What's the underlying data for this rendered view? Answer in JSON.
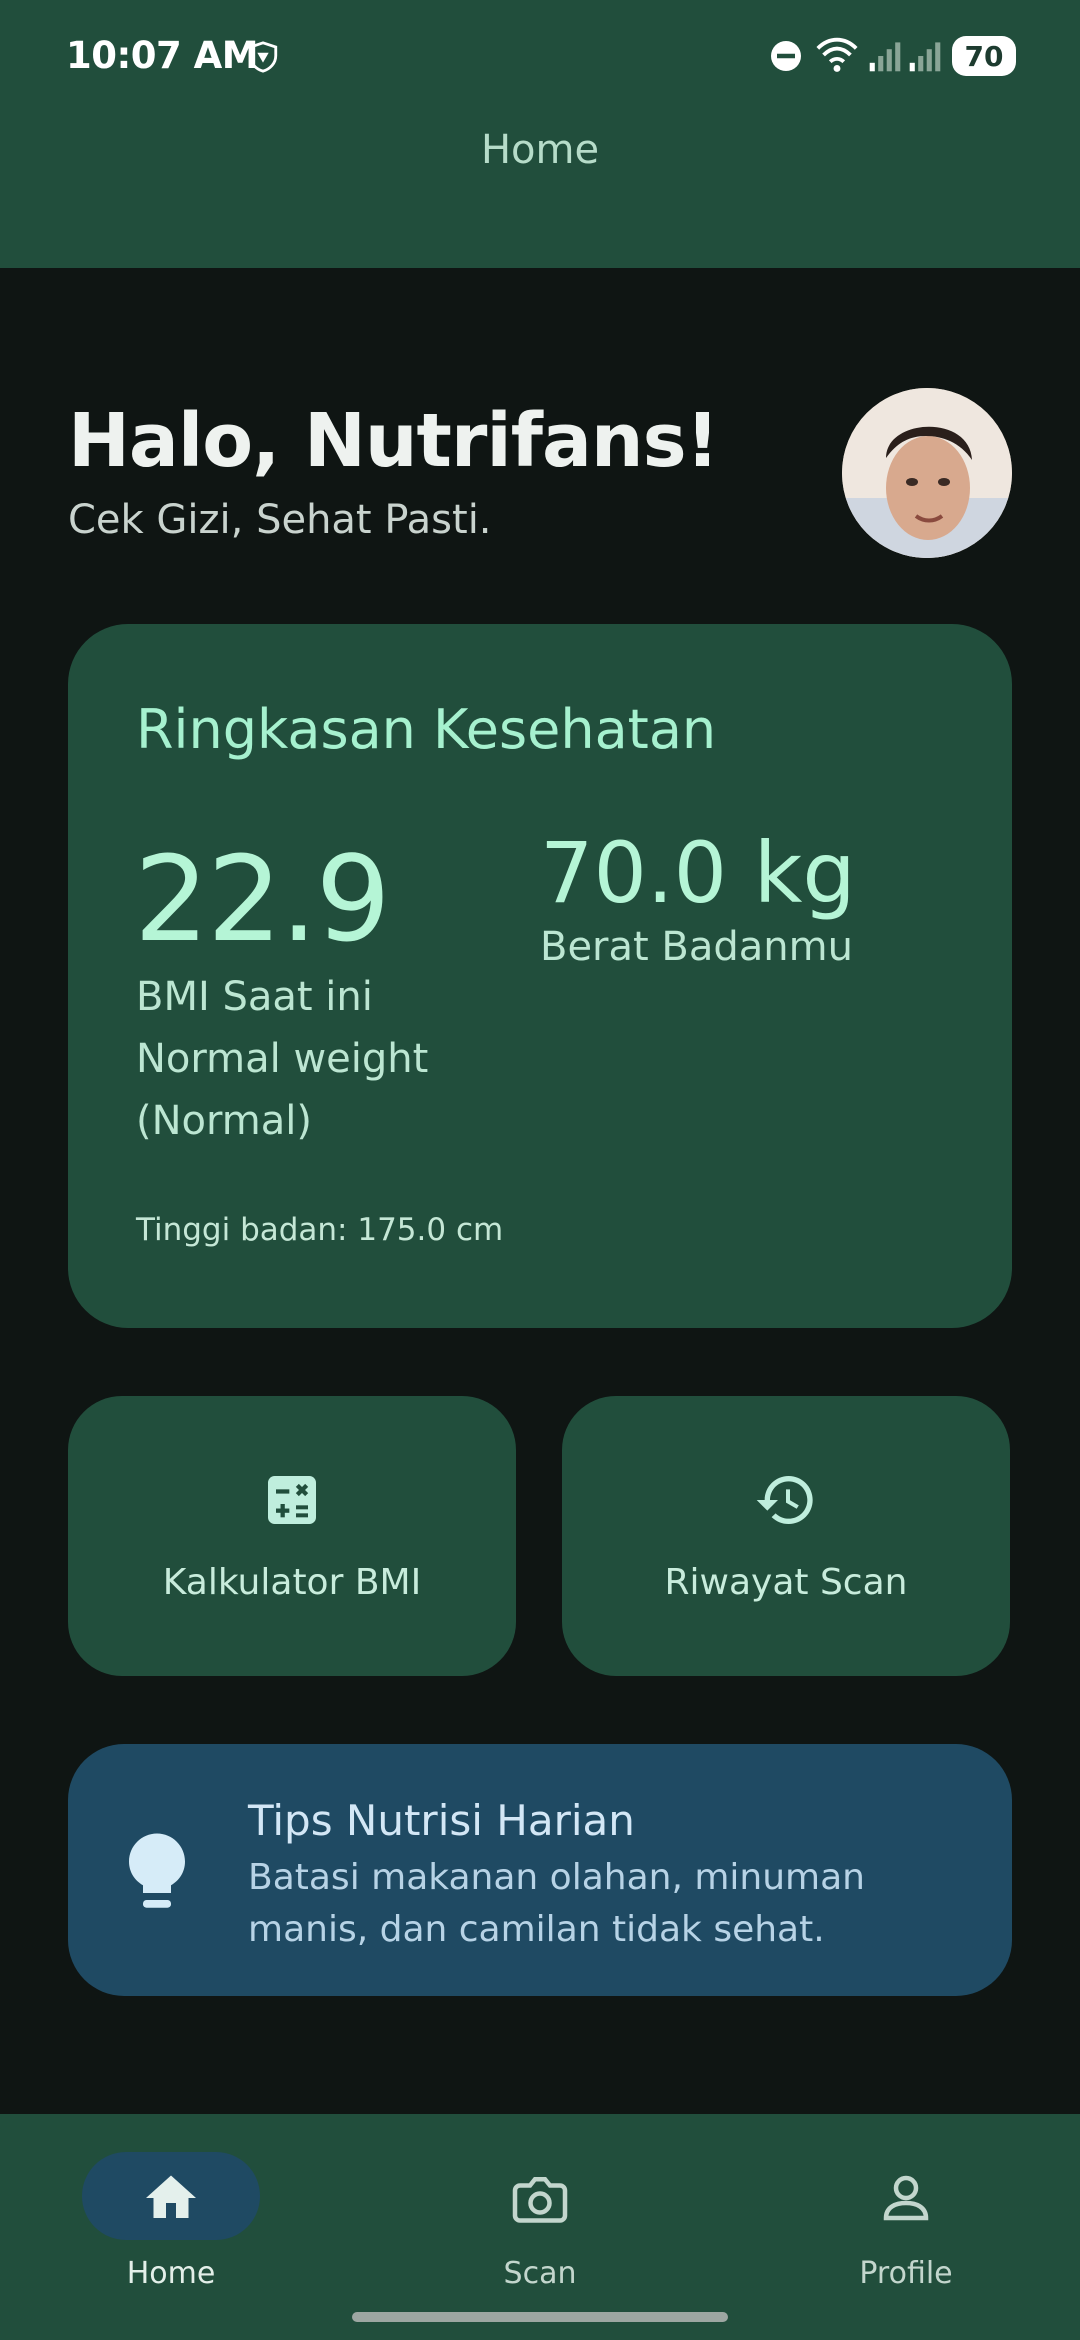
{
  "status_bar": {
    "time": "10:07 AM",
    "battery": "70"
  },
  "app_bar": {
    "title": "Home"
  },
  "greeting": {
    "title": "Halo, Nutrifans!",
    "subtitle": "Cek Gizi, Sehat Pasti."
  },
  "summary": {
    "title": "Ringkasan Kesehatan",
    "bmi_value": "22.9",
    "bmi_label_lines": [
      "BMI Saat ini",
      "Normal weight",
      "(Normal)"
    ],
    "weight_value": "70.0 kg",
    "weight_label": "Berat Badanmu",
    "height": "Tinggi badan: 175.0 cm"
  },
  "actions": [
    {
      "label": "Kalkulator BMI",
      "icon": "calculator-icon"
    },
    {
      "label": "Riwayat Scan",
      "icon": "history-icon"
    }
  ],
  "tips": {
    "title": "Tips Nutrisi Harian",
    "body": "Batasi makanan olahan, minuman manis, dan camilan tidak sehat.",
    "icon": "lightbulb-icon"
  },
  "bottom_nav": [
    {
      "label": "Home",
      "icon": "home-icon",
      "selected": true
    },
    {
      "label": "Scan",
      "icon": "camera-icon",
      "selected": false
    },
    {
      "label": "Profile",
      "icon": "person-icon",
      "selected": false
    }
  ],
  "colors": {
    "background": "#0f1513",
    "surface_green": "#214e3c",
    "tips_blue": "#1f4a63",
    "accent_mint": "#b5f5d6"
  }
}
